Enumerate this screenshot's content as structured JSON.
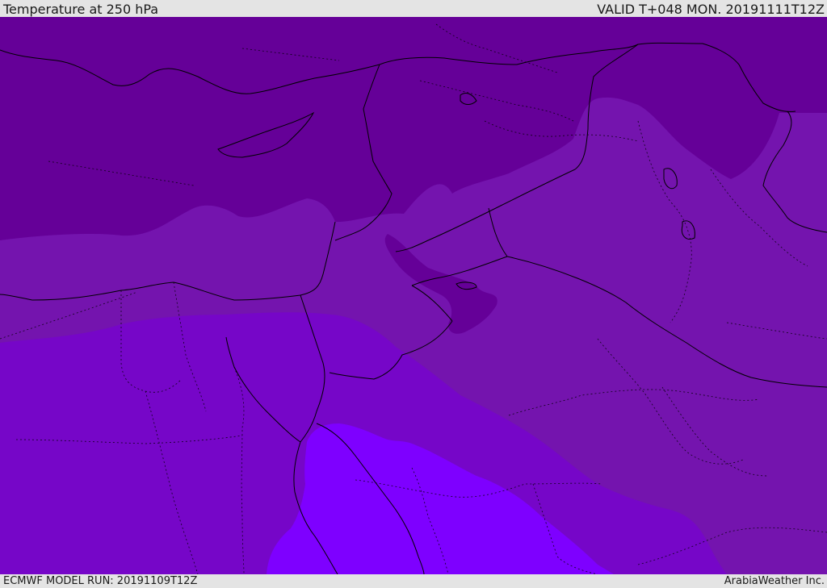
{
  "header": {
    "title": "Temperature at 250 hPa",
    "valid": "VALID T+048 MON. 20191111T12Z"
  },
  "footer": {
    "model_run": "ECMWF MODEL RUN: 20191109T12Z",
    "credit": "ArabiaWeather Inc."
  },
  "colors": {
    "coldest": "#650098",
    "cold": "#7414ae",
    "mid": "#7606c8",
    "warm": "#7e00ff",
    "boundary_line": "#000000"
  }
}
